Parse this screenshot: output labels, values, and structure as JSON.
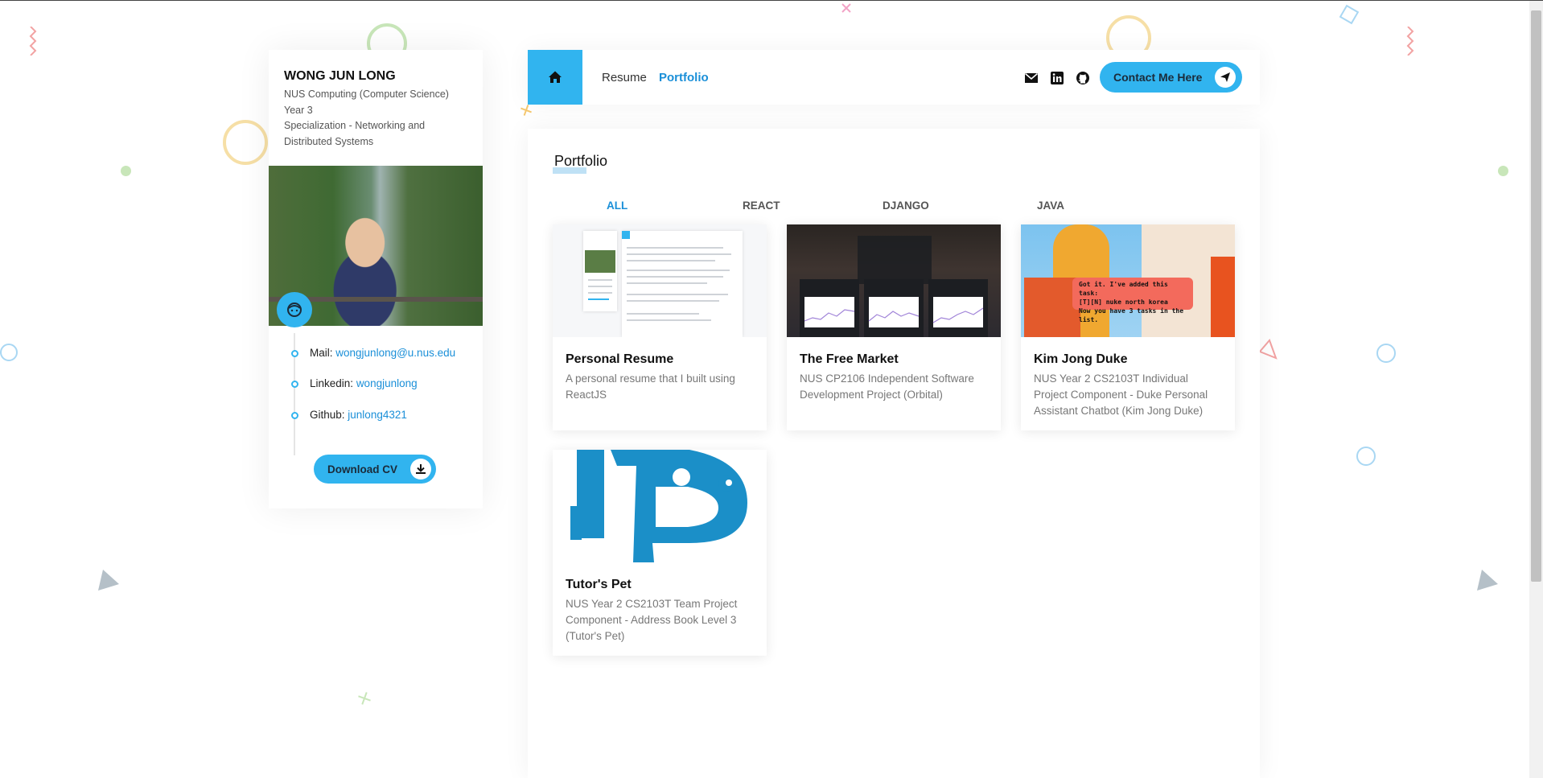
{
  "profile": {
    "name": "WONG JUN LONG",
    "lines": [
      "NUS Computing (Computer Science)",
      "Year 3",
      "Specialization - Networking and Distributed Systems"
    ],
    "contacts": [
      {
        "label": "Mail:",
        "value": "wongjunlong@u.nus.edu"
      },
      {
        "label": "Linkedin:",
        "value": "wongjunlong"
      },
      {
        "label": "Github:",
        "value": "junlong4321"
      }
    ],
    "download_label": "Download CV"
  },
  "nav": {
    "links": [
      "Resume",
      "Portfolio"
    ],
    "active": "Portfolio",
    "contact_label": "Contact Me Here",
    "social_icons": [
      "mail-icon",
      "linkedin-icon",
      "github-icon"
    ]
  },
  "portfolio": {
    "title": "Portfolio",
    "filters": [
      "ALL",
      "REACT",
      "DJANGO",
      "JAVA"
    ],
    "active_filter": "ALL",
    "projects": [
      {
        "title": "Personal Resume",
        "description": "A personal resume that I built using ReactJS"
      },
      {
        "title": "The Free Market",
        "description": "NUS CP2106 Independent Software Development Project (Orbital)"
      },
      {
        "title": "Kim Jong Duke",
        "description": "NUS Year 2 CS2103T Individual Project Component - Duke Personal Assistant Chatbot (Kim Jong Duke)"
      },
      {
        "title": "Tutor's Pet",
        "description": "NUS Year 2 CS2103T Team Project Component - Address Book Level 3 (Tutor's Pet)"
      }
    ],
    "thumb_texts": {
      "chat_bubble": [
        "Got it. I've added this task:",
        "[T][N] nuke north korea",
        "Now you have 3 tasks in the list."
      ]
    }
  },
  "colors": {
    "accent": "#31b4ef",
    "link": "#1a8fd8"
  }
}
